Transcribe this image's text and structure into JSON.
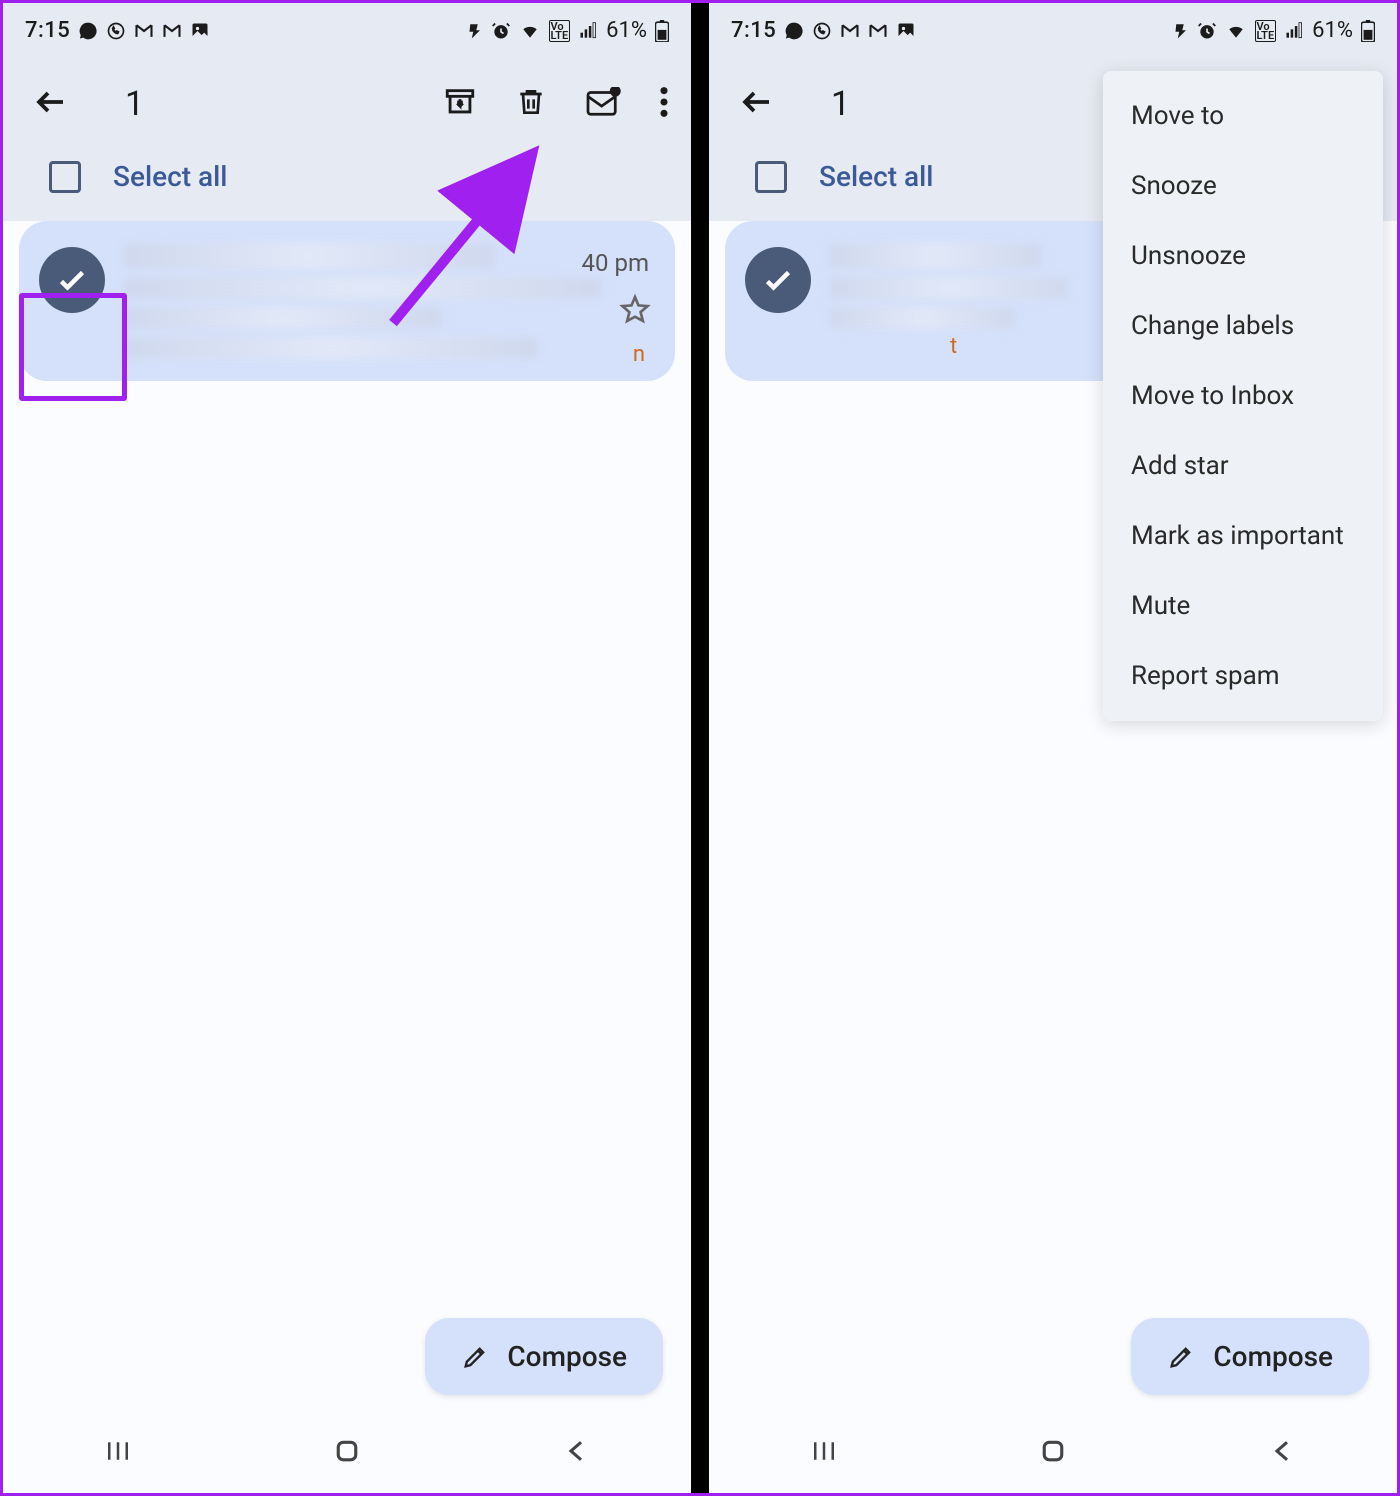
{
  "statusbar": {
    "time": "7:15",
    "battery": "61%"
  },
  "appbar": {
    "selected_count": "1"
  },
  "selectall_label": "Select all",
  "email": {
    "timestamp": "40 pm",
    "orange_fragment_left": "n",
    "orange_fragment_right": "t"
  },
  "compose_label": "Compose",
  "menu": {
    "items": [
      "Move to",
      "Snooze",
      "Unsnooze",
      "Change labels",
      "Move to Inbox",
      "Add star",
      "Mark as important",
      "Mute",
      "Report spam"
    ]
  },
  "colors": {
    "accent_purple": "#a020f0",
    "avatar_bg": "#4a5b79",
    "email_bg": "#d5e1fb",
    "header_bg": "#e6eaf2"
  }
}
